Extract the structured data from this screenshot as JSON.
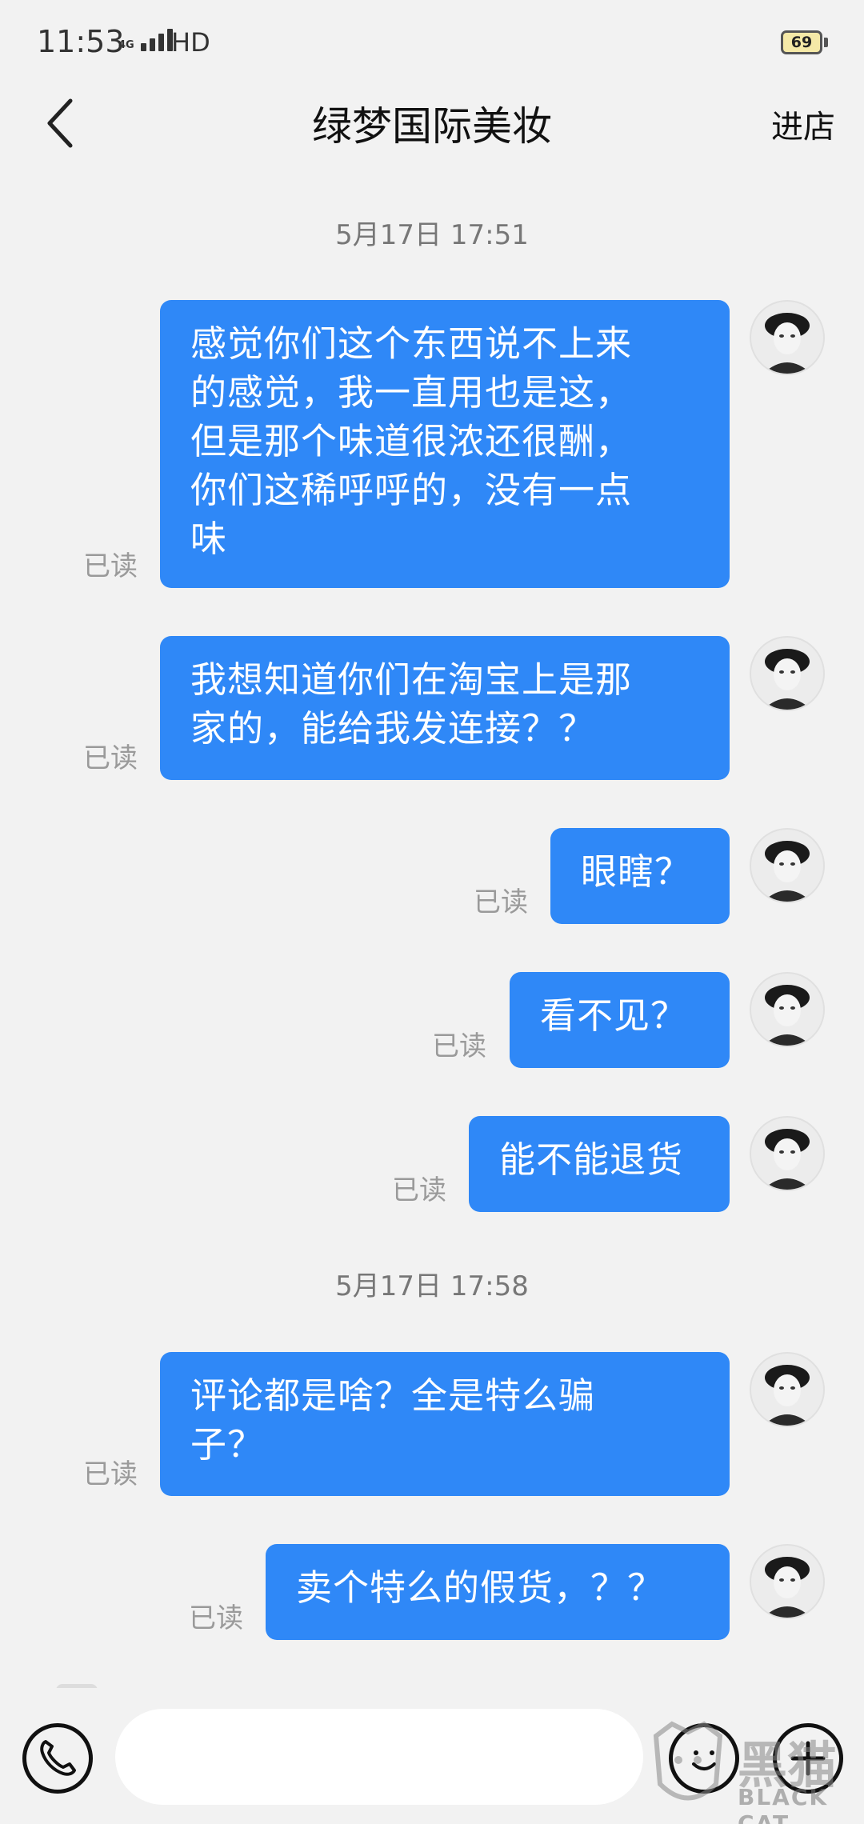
{
  "status_bar": {
    "time": "11:53",
    "network": "4G",
    "hd": "HD",
    "battery": "69"
  },
  "nav": {
    "title": "绿梦国际美妆",
    "right_action": "进店"
  },
  "timestamps": [
    "5月17日 17:51",
    "5月17日 17:58"
  ],
  "messages": [
    {
      "lines": [
        "感觉你们这个东西说不上来",
        "的感觉，我一直用也是这，",
        "但是那个味道很浓还很酬，",
        "你们这稀呼呼的，没有一点",
        "味"
      ],
      "status": "已读"
    },
    {
      "lines": [
        "我想知道你们在淘宝上是那",
        "家的，能给我发连接？？"
      ],
      "status": "已读"
    },
    {
      "lines": [
        "眼瞎？"
      ],
      "status": "已读"
    },
    {
      "lines": [
        "看不见？"
      ],
      "status": "已读"
    },
    {
      "lines": [
        "能不能退货"
      ],
      "status": "已读"
    },
    {
      "lines": [
        "评论都是啥？全是特么骗",
        "子？"
      ],
      "status": "已读"
    },
    {
      "lines": [
        "卖个特么的假货，？？"
      ],
      "status": "已读"
    }
  ],
  "input": {
    "placeholder": ""
  },
  "watermark": {
    "cn": "黑猫",
    "en": "BLACK CAT"
  },
  "colors": {
    "bubble": "#2f88f7",
    "background": "#f2f2f2",
    "read_status": "#9a9a9a"
  },
  "icons": [
    "back-arrow-icon",
    "phone-icon",
    "emoji-icon",
    "plus-icon"
  ]
}
